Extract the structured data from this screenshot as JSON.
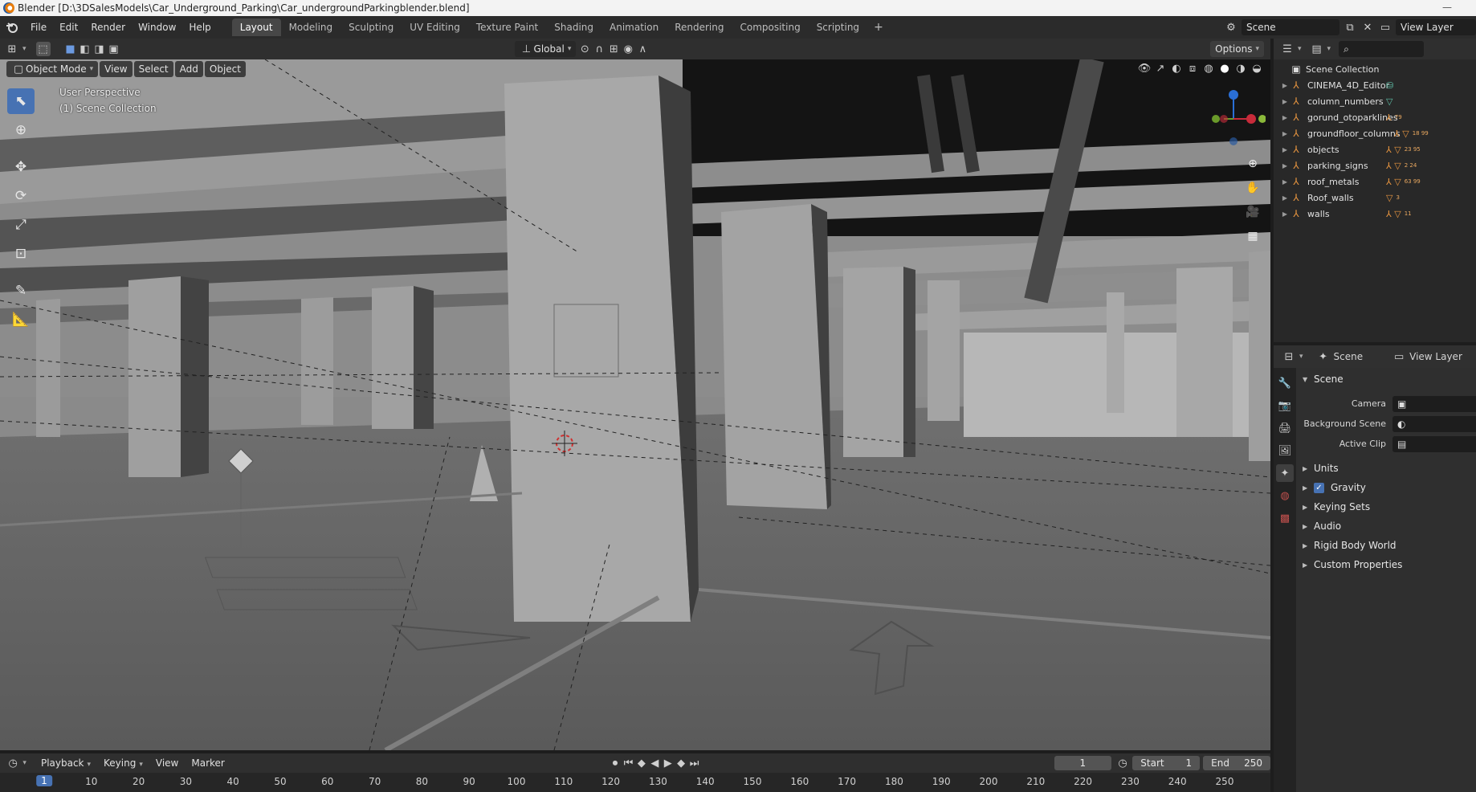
{
  "window": {
    "title": "Blender [D:\\3DSalesModels\\Car_Underground_Parking\\Car_undergroundParkingblender.blend]",
    "minimize": "—"
  },
  "menus": [
    "File",
    "Edit",
    "Render",
    "Window",
    "Help"
  ],
  "workspaces": [
    "Layout",
    "Modeling",
    "Sculpting",
    "UV Editing",
    "Texture Paint",
    "Shading",
    "Animation",
    "Rendering",
    "Compositing",
    "Scripting"
  ],
  "active_workspace": "Layout",
  "scene_field": "Scene",
  "view_layer_field": "View Layer",
  "viewport_header": {
    "mode": "Object Mode",
    "menu": [
      "View",
      "Select",
      "Add",
      "Object"
    ],
    "transform_orientation": "Global",
    "options": "Options"
  },
  "viewport": {
    "perspective_label": "User Perspective",
    "collection_label": "(1) Scene Collection",
    "gizmo_axes": [
      "Z",
      "Y",
      "X"
    ]
  },
  "outliner": {
    "root": "Scene Collection",
    "items": [
      {
        "name": "CINEMA_4D_Editor",
        "icons": "⛁",
        "count": "",
        "teal": true
      },
      {
        "name": "column_numbers",
        "icons": "▽",
        "count": "",
        "teal": true
      },
      {
        "name": "gorund_otoparklines",
        "icons": "⅄",
        "count": "79",
        "teal": false
      },
      {
        "name": "groundfloor_columns",
        "icons": "⅄ ▽",
        "count": "18  99",
        "teal": false
      },
      {
        "name": "objects",
        "icons": "⅄ ▽",
        "count": "23  95",
        "teal": false
      },
      {
        "name": "parking_signs",
        "icons": "⅄ ▽",
        "count": "2  24",
        "teal": false
      },
      {
        "name": "roof_metals",
        "icons": "⅄ ▽",
        "count": "63  99",
        "teal": false
      },
      {
        "name": "Roof_walls",
        "icons": "▽",
        "count": "3",
        "teal": false
      },
      {
        "name": "walls",
        "icons": "⅄ ▽",
        "count": "11",
        "teal": false
      }
    ]
  },
  "properties": {
    "scene_tab": "Scene",
    "view_layer_tab": "View Layer",
    "panel_title": "Scene",
    "rows": [
      {
        "label": "Camera",
        "icon": "▣"
      },
      {
        "label": "Background Scene",
        "icon": "◐"
      },
      {
        "label": "Active Clip",
        "icon": "▤"
      }
    ],
    "sections": [
      "Units",
      "Gravity",
      "Keying Sets",
      "Audio",
      "Rigid Body World",
      "Custom Properties"
    ],
    "gravity_checked": true
  },
  "timeline": {
    "menus": [
      "Playback",
      "Keying",
      "View",
      "Marker"
    ],
    "current_frame": "1",
    "start_label": "Start",
    "start": "1",
    "end_label": "End",
    "end": "250",
    "ticks": [
      "1",
      "10",
      "20",
      "30",
      "40",
      "50",
      "60",
      "70",
      "80",
      "90",
      "100",
      "110",
      "120",
      "130",
      "140",
      "150",
      "160",
      "170",
      "180",
      "190",
      "200",
      "210",
      "220",
      "230",
      "240",
      "250"
    ]
  }
}
